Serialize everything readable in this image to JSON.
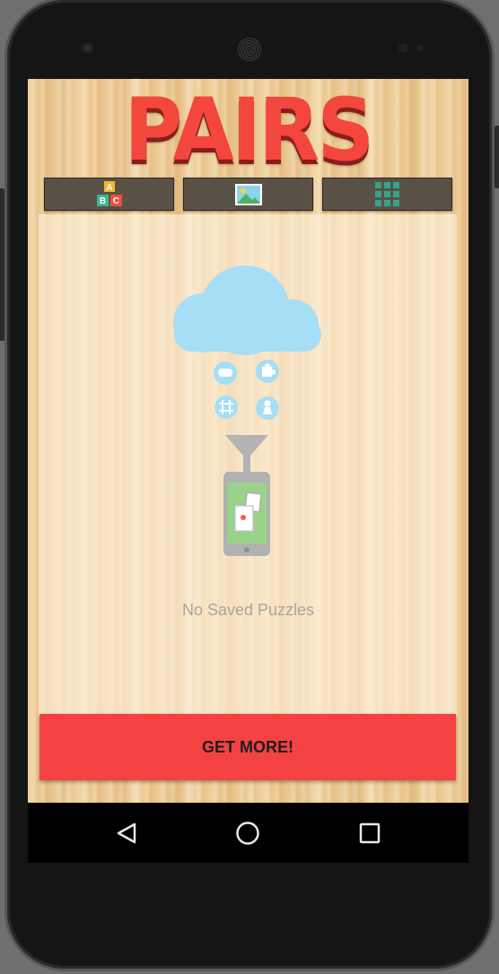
{
  "app": {
    "title": "PAIRS",
    "title_color": "#f3463d"
  },
  "tabs": [
    {
      "name": "alphabet-blocks-icon",
      "letters": [
        "A",
        "B",
        "C"
      ]
    },
    {
      "name": "picture-icon"
    },
    {
      "name": "grid-icon"
    }
  ],
  "empty_state": {
    "message": "No Saved Puzzles",
    "illustration": "cloud-download-to-phone"
  },
  "actions": {
    "get_more_label": "GET MORE!",
    "get_more_color": "#f44242"
  },
  "navigation": {
    "back": "back-icon",
    "home": "home-icon",
    "recents": "recents-icon"
  }
}
